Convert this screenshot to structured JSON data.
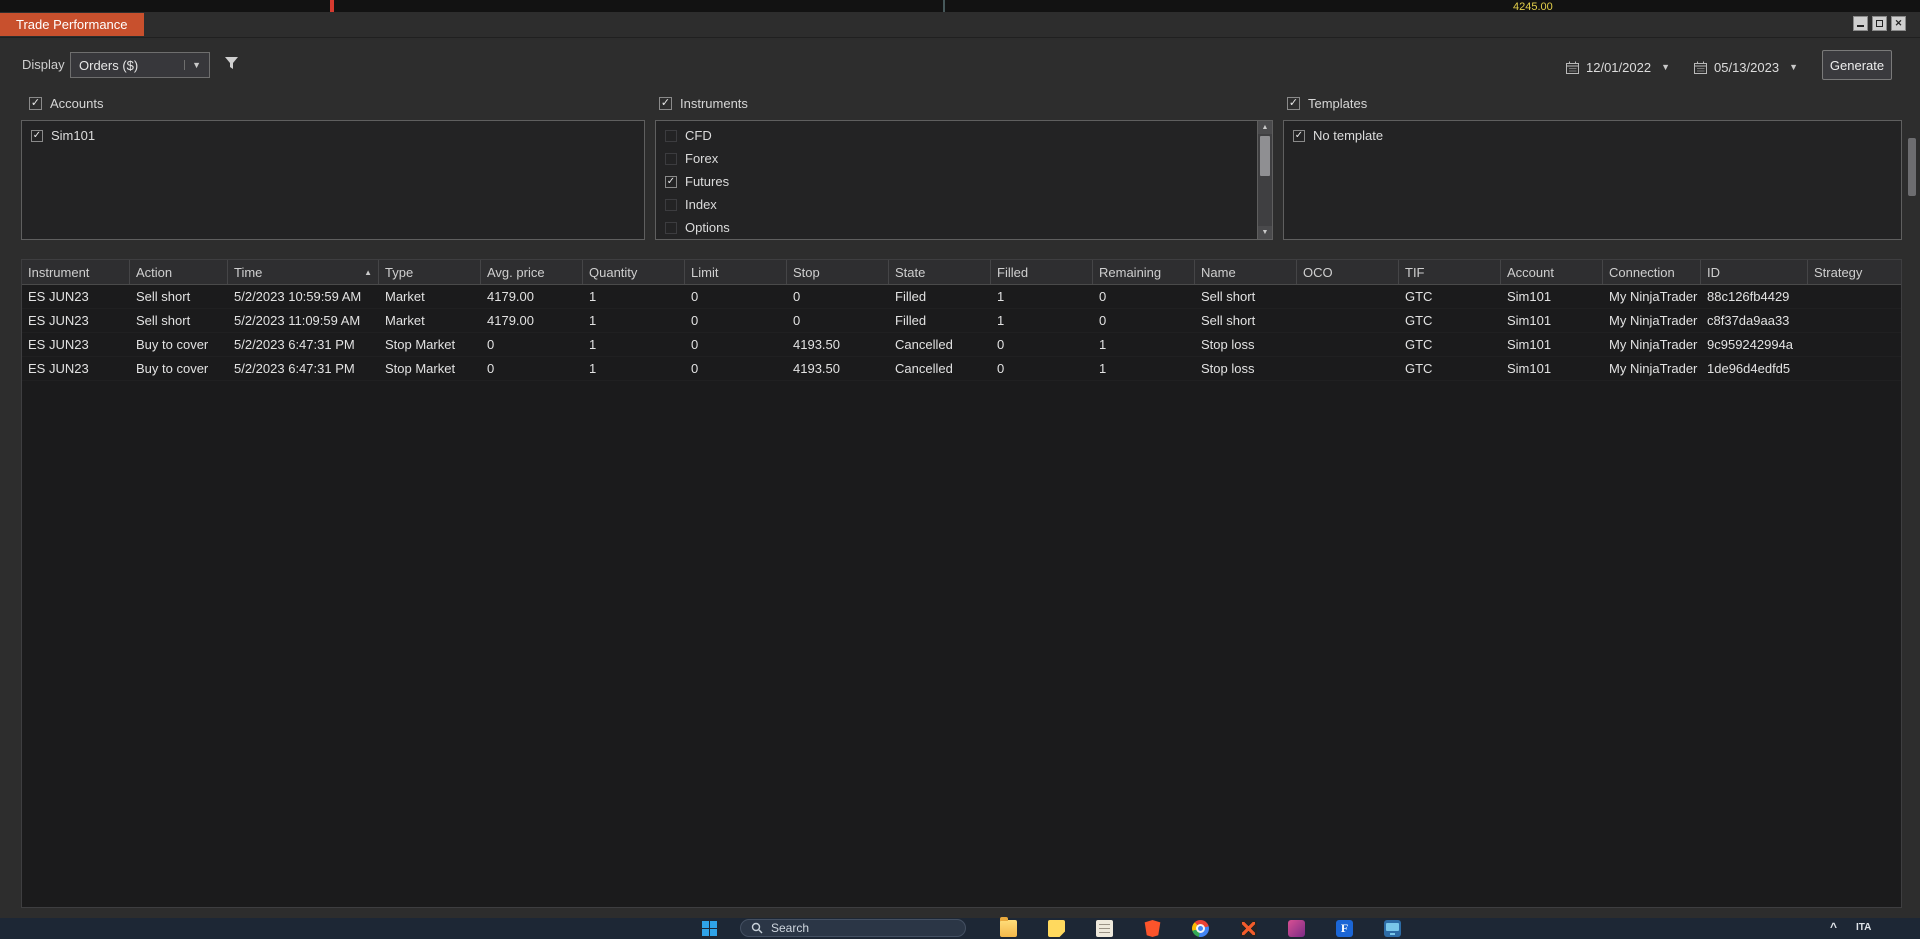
{
  "top_strip": {
    "price_text": "4245.00"
  },
  "window": {
    "title": "Trade Performance"
  },
  "toolbar": {
    "display_label": "Display",
    "display_value": "Orders ($)",
    "date_from": "12/01/2022",
    "date_to": "05/13/2023",
    "generate_label": "Generate"
  },
  "filters": {
    "accounts": {
      "label": "Accounts",
      "checked": true,
      "items": [
        {
          "label": "Sim101",
          "checked": true
        }
      ]
    },
    "instruments": {
      "label": "Instruments",
      "checked": true,
      "items": [
        {
          "label": "CFD",
          "checked": false
        },
        {
          "label": "Forex",
          "checked": false
        },
        {
          "label": "Futures",
          "checked": true
        },
        {
          "label": "Index",
          "checked": false
        },
        {
          "label": "Options",
          "checked": false
        }
      ]
    },
    "templates": {
      "label": "Templates",
      "checked": true,
      "items": [
        {
          "label": "No template",
          "checked": true
        }
      ]
    }
  },
  "orders_table": {
    "columns": [
      "Instrument",
      "Action",
      "Time",
      "Type",
      "Avg. price",
      "Quantity",
      "Limit",
      "Stop",
      "State",
      "Filled",
      "Remaining",
      "Name",
      "OCO",
      "TIF",
      "Account",
      "Connection",
      "ID",
      "Strategy"
    ],
    "sort": {
      "column": "Time",
      "direction": "asc"
    },
    "rows": [
      [
        "ES JUN23",
        "Sell short",
        "5/2/2023 10:59:59 AM",
        "Market",
        "4179.00",
        "1",
        "0",
        "0",
        "Filled",
        "1",
        "0",
        "Sell short",
        "",
        "GTC",
        "Sim101",
        "My NinjaTrader",
        "88c126fb4429",
        ""
      ],
      [
        "ES JUN23",
        "Sell short",
        "5/2/2023 11:09:59 AM",
        "Market",
        "4179.00",
        "1",
        "0",
        "0",
        "Filled",
        "1",
        "0",
        "Sell short",
        "",
        "GTC",
        "Sim101",
        "My NinjaTrader",
        "c8f37da9aa33",
        ""
      ],
      [
        "ES JUN23",
        "Buy to cover",
        "5/2/2023 6:47:31 PM",
        "Stop Market",
        "0",
        "1",
        "0",
        "4193.50",
        "Cancelled",
        "0",
        "1",
        "Stop loss",
        "",
        "GTC",
        "Sim101",
        "My NinjaTrader",
        "9c959242994a",
        ""
      ],
      [
        "ES JUN23",
        "Buy to cover",
        "5/2/2023 6:47:31 PM",
        "Stop Market",
        "0",
        "1",
        "0",
        "4193.50",
        "Cancelled",
        "0",
        "1",
        "Stop loss",
        "",
        "GTC",
        "Sim101",
        "My NinjaTrader",
        "1de96d4edfd5",
        ""
      ]
    ]
  },
  "taskbar": {
    "search_placeholder": "Search",
    "language": "ITA",
    "icons": [
      {
        "name": "file-explorer"
      },
      {
        "name": "sticky-notes"
      },
      {
        "name": "notepad"
      },
      {
        "name": "brave"
      },
      {
        "name": "chrome"
      },
      {
        "name": "ninjatrader"
      },
      {
        "name": "magenta-app"
      },
      {
        "name": "f-app",
        "glyph": "F"
      },
      {
        "name": "display"
      }
    ]
  },
  "colors": {
    "title_accent": "#c8502d",
    "taskbar_bg": "#1d2735",
    "panel_border": "#5f5f5f",
    "grid_bg": "#1b1b1c"
  }
}
